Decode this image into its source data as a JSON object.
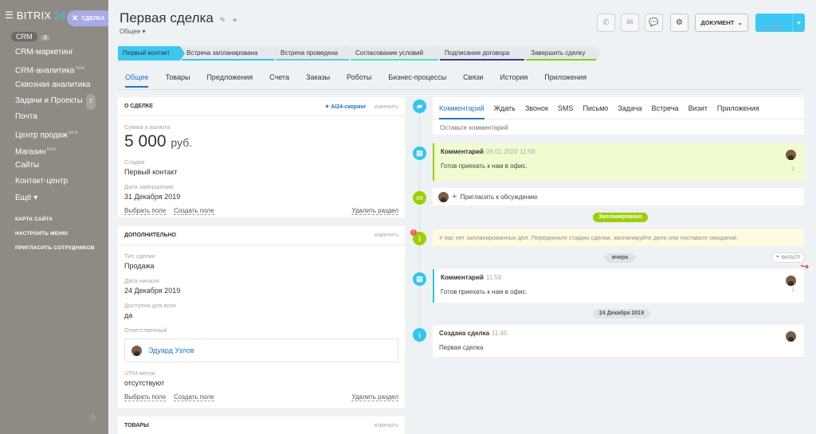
{
  "sidebar": {
    "logo": "BITRIX",
    "logo_num": "24",
    "crm_badge": "CRM",
    "crm_count": "3",
    "tasks_count": "2",
    "items": [
      "CRM-маркетинг",
      "CRM-аналитика",
      "Сквозная аналитика",
      "Задачи и Проекты",
      "Почта",
      "Центр продаж",
      "Магазин",
      "Сайты",
      "Контакт-центр",
      "Ещё"
    ],
    "links": [
      "КАРТА САЙТА",
      "НАСТРОИТЬ МЕНЮ",
      "ПРИГЛАСИТЬ СОТРУДНИКОВ"
    ]
  },
  "deal_tag": "СДЕЛКА",
  "header": {
    "title": "Первая сделка",
    "subtitle": "Общее",
    "doc_button": "ДОКУМЕНТ",
    "invoice_button": "СЧЁТ"
  },
  "stages": [
    {
      "label": "Первый контакт",
      "color": "#39c9f0",
      "active": true
    },
    {
      "label": "Встреча запланирована",
      "color": "#2fc6f6"
    },
    {
      "label": "Встреча проведена",
      "color": "#55d0e0"
    },
    {
      "label": "Согласование условий",
      "color": "#47e4c2"
    },
    {
      "label": "Подписание договора",
      "color": "#2e3f9b"
    },
    {
      "label": "Завершить сделку",
      "color": "#7bd500"
    }
  ],
  "tabs": [
    "Общее",
    "Товары",
    "Предложения",
    "Счета",
    "Заказы",
    "Роботы",
    "Бизнес-процессы",
    "Связи",
    "История",
    "Приложения"
  ],
  "about": {
    "head": "О СДЕЛКЕ",
    "ai": "AI24-скоринг",
    "edit": "изменить",
    "sum_label": "Сумма и валюта",
    "sum_value": "5 000",
    "currency": "руб.",
    "stage_label": "Стадия",
    "stage_value": "Первый контакт",
    "close_label": "Дата завершения",
    "close_value": "31 Декабря 2019",
    "select_field": "Выбрать поле",
    "create_field": "Создать поле",
    "delete_section": "Удалить раздел"
  },
  "extra": {
    "head": "ДОПОЛНИТЕЛЬНО",
    "edit": "изменить",
    "type_label": "Тип сделки",
    "type_value": "Продажа",
    "start_label": "Дата начала",
    "start_value": "24 Декабря 2019",
    "avail_label": "Доступна для всех",
    "avail_value": "да",
    "resp_label": "Ответственный",
    "resp_value": "Эдуард Узлов",
    "utm_label": "UTM-метки",
    "utm_value": "отсутствуют",
    "select_field": "Выбрать поле",
    "create_field": "Создать поле",
    "delete_section": "Удалить раздел"
  },
  "goods": {
    "head": "ТОВАРЫ",
    "edit": "изменить"
  },
  "timeline": {
    "tabs": [
      "Комментарий",
      "Ждать",
      "Звонок",
      "SMS",
      "Письмо",
      "Задача",
      "Встреча",
      "Визит",
      "Приложения"
    ],
    "placeholder": "Оставьте комментарий",
    "pinned": {
      "title": "Комментарий",
      "time": "09.01.2020 11:58",
      "text": "Готов приехать к нам в офис.",
      "num": "1"
    },
    "invite": "Пригласить к обсуждению",
    "planned": "Запланировано",
    "planned_text": "У вас нет запланированных дел. Передвиньте стадию сделки, запланируйте дело или поставьте ожидание.",
    "yesterday": "вчера",
    "filter": "ФИЛЬТР",
    "comment": {
      "title": "Комментарий",
      "time": "11:58",
      "text": "Готов приехать к нам в офис.",
      "num": "1"
    },
    "date": "24 Декабря 2019",
    "created": {
      "title": "Создана сделка",
      "time": "11:45",
      "text": "Первая сделка"
    }
  }
}
